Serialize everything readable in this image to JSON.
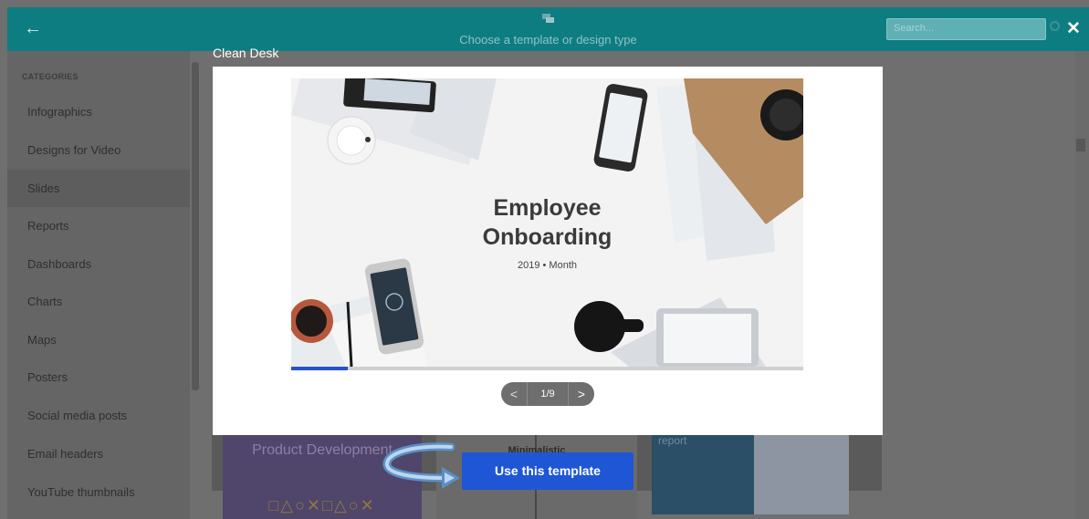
{
  "topbar": {
    "back_icon": "arrow-left-icon",
    "title": "Choose a template or design type",
    "search_placeholder": "Search..."
  },
  "sidebar": {
    "header": "CATEGORIES",
    "items": [
      {
        "label": "Infographics"
      },
      {
        "label": "Designs for Video"
      },
      {
        "label": "Slides",
        "active": true
      },
      {
        "label": "Reports"
      },
      {
        "label": "Dashboards"
      },
      {
        "label": "Charts"
      },
      {
        "label": "Maps"
      },
      {
        "label": "Posters"
      },
      {
        "label": "Social media posts"
      },
      {
        "label": "Email headers"
      },
      {
        "label": "YouTube thumbnails"
      }
    ]
  },
  "background_cards": {
    "product": {
      "title": "Product Development",
      "shapes": "□△○✕□△○✕"
    },
    "minimalistic": {
      "title": "Minimalistic"
    },
    "report": {
      "title": "report"
    }
  },
  "modal": {
    "title": "Clean Desk",
    "slide": {
      "title_line1": "Employee",
      "title_line2": "Onboarding",
      "subtitle": "2019  •  Month"
    },
    "progress": 0.111,
    "pager": {
      "prev": "<",
      "count": "1/9",
      "next": ">"
    },
    "use_button": "Use this template"
  },
  "colors": {
    "topbar": "#0e7d81",
    "primary_button": "#1e56d6",
    "progress": "#2753c9"
  }
}
